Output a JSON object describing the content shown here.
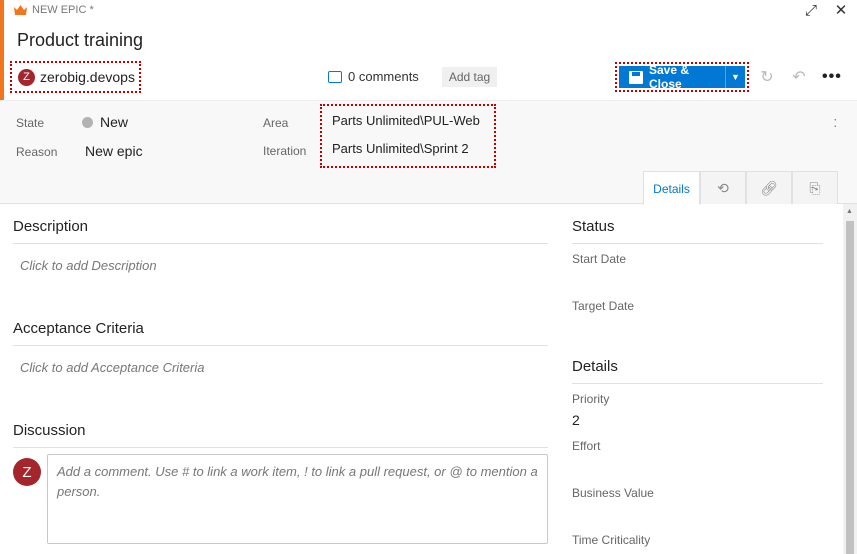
{
  "header": {
    "type_label": "NEW EPIC *",
    "title": "Product training",
    "assignee": {
      "initial": "Z",
      "name": "zerobig.devops"
    },
    "comments_label": "0 comments",
    "add_tag_label": "Add tag",
    "save_label": "Save & Close",
    "icons": [
      "crown-icon",
      "expand-icon",
      "close-icon",
      "refresh-icon",
      "undo-icon",
      "more-icon"
    ]
  },
  "fields": {
    "state_label": "State",
    "state_value": "New",
    "reason_label": "Reason",
    "reason_value": "New epic",
    "area_label": "Area",
    "area_value": "Parts Unlimited\\PUL-Web",
    "iteration_label": "Iteration",
    "iteration_value": "Parts Unlimited\\Sprint 2"
  },
  "tabs": {
    "details_label": "Details",
    "icons": [
      "history-icon",
      "link-icon",
      "attachment-icon"
    ]
  },
  "left": {
    "description_title": "Description",
    "description_placeholder": "Click to add Description",
    "acceptance_title": "Acceptance Criteria",
    "acceptance_placeholder": "Click to add Acceptance Criteria",
    "discussion_title": "Discussion",
    "discussion_avatar": "Z",
    "comment_placeholder": "Add a comment. Use # to link a work item, ! to link a pull request, or @ to mention a person."
  },
  "right": {
    "status_title": "Status",
    "start_date_label": "Start Date",
    "target_date_label": "Target Date",
    "details_title": "Details",
    "priority_label": "Priority",
    "priority_value": "2",
    "effort_label": "Effort",
    "business_value_label": "Business Value",
    "time_criticality_label": "Time Criticality"
  },
  "colors": {
    "accent": "#0078d4",
    "epic_orange": "#f2761d",
    "avatar": "#a4262c",
    "highlight_border": "#c00000"
  }
}
